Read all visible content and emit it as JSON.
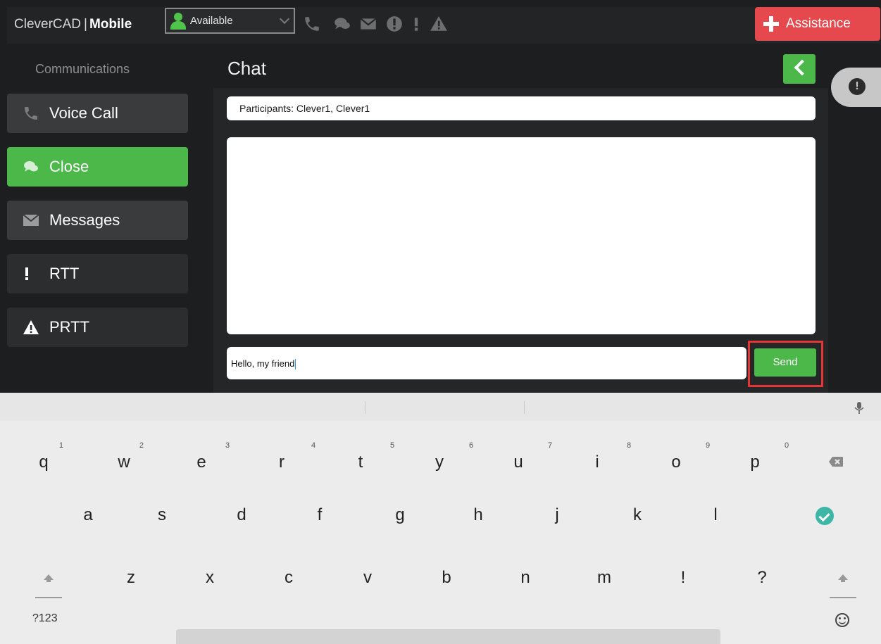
{
  "app": {
    "brand_left": "CleverCAD",
    "brand_right": "Mobile",
    "status": "Available",
    "assistance_label": "Assistance",
    "accent_green": "#4cb84a",
    "alert_red": "#e5484d"
  },
  "sidebar": {
    "title": "Communications",
    "items": [
      {
        "label": "Voice Call",
        "icon": "phone-icon"
      },
      {
        "label": "Close",
        "icon": "chat-icon"
      },
      {
        "label": "Messages",
        "icon": "envelope-icon"
      },
      {
        "label": "RTT",
        "icon": "exclamation-icon"
      },
      {
        "label": "PRTT",
        "icon": "warning-icon"
      }
    ]
  },
  "chat": {
    "title": "Chat",
    "participants": "Participants: Clever1, Clever1",
    "message_text": "Hello, my friend",
    "send_label": "Send"
  },
  "keyboard": {
    "row1": [
      {
        "key": "q",
        "hint": "1"
      },
      {
        "key": "w",
        "hint": "2"
      },
      {
        "key": "e",
        "hint": "3"
      },
      {
        "key": "r",
        "hint": "4"
      },
      {
        "key": "t",
        "hint": "5"
      },
      {
        "key": "y",
        "hint": "6"
      },
      {
        "key": "u",
        "hint": "7"
      },
      {
        "key": "i",
        "hint": "8"
      },
      {
        "key": "o",
        "hint": "9"
      },
      {
        "key": "p",
        "hint": "0"
      }
    ],
    "row2": [
      "a",
      "s",
      "d",
      "f",
      "g",
      "h",
      "j",
      "k",
      "l"
    ],
    "row3": [
      "z",
      "x",
      "c",
      "v",
      "b",
      "n",
      "m",
      "!",
      "?"
    ],
    "symbols_label": "?123"
  }
}
